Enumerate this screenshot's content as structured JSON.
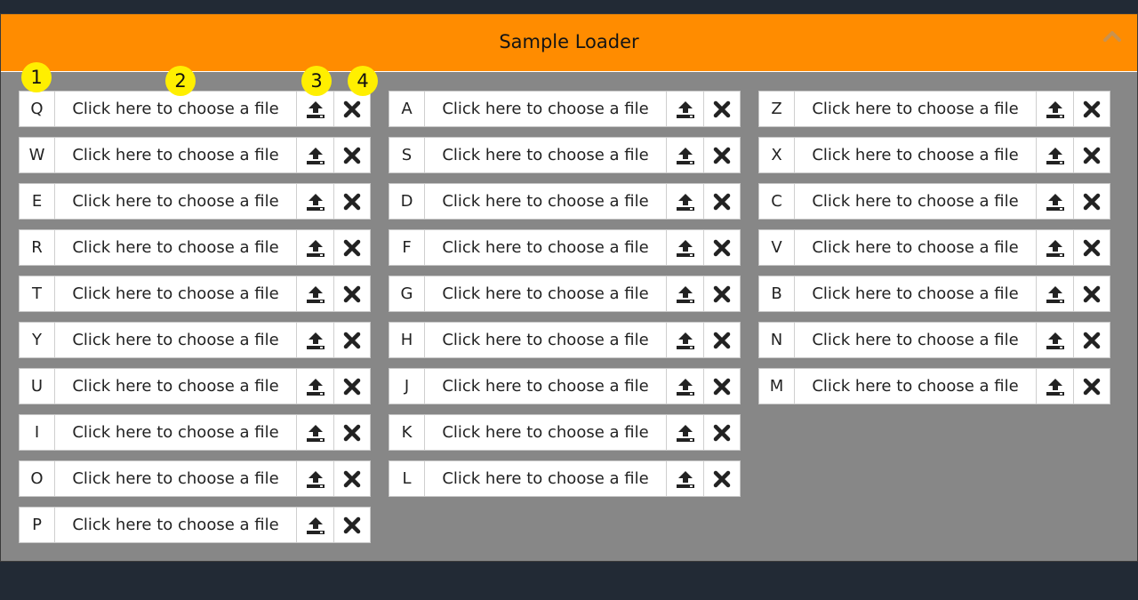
{
  "header": {
    "title": "Sample Loader",
    "collapse_icon": "chevron-up-icon"
  },
  "file_placeholder": "Click here to choose a file",
  "columns": [
    [
      "Q",
      "W",
      "E",
      "R",
      "T",
      "Y",
      "U",
      "I",
      "O",
      "P"
    ],
    [
      "A",
      "S",
      "D",
      "F",
      "G",
      "H",
      "J",
      "K",
      "L"
    ],
    [
      "Z",
      "X",
      "C",
      "V",
      "B",
      "N",
      "M"
    ]
  ],
  "row_icons": {
    "upload": "upload-icon",
    "clear": "close-icon"
  },
  "annotations": [
    "1",
    "2",
    "3",
    "4"
  ],
  "colors": {
    "header": "#ff8c00",
    "panel": "#878787",
    "background": "#222a35",
    "badge": "#ffef00"
  }
}
